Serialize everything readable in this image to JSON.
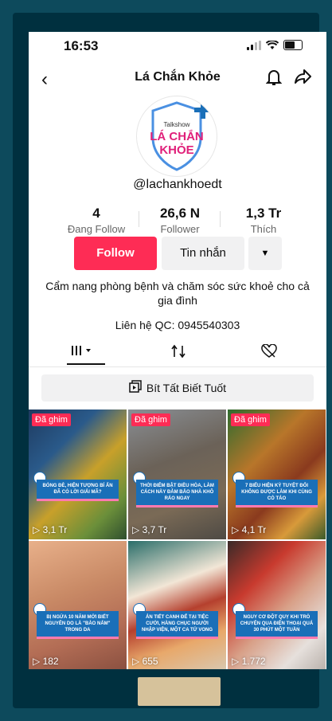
{
  "status_bar": {
    "time": "16:53"
  },
  "nav": {
    "title": "Lá Chắn Khỏe"
  },
  "avatar": {
    "line1": "Talkshow",
    "line2": "LÁ CHẮN",
    "line3": "KHỎE"
  },
  "profile": {
    "username": "@lachankhoedt",
    "stats": [
      {
        "value": "4",
        "label": "Đang Follow"
      },
      {
        "value": "26,6 N",
        "label": "Follower"
      },
      {
        "value": "1,3 Tr",
        "label": "Thích"
      }
    ],
    "follow_label": "Follow",
    "message_label": "Tin nhắn",
    "bio": "Cẩm nang phòng bệnh và chăm sóc sức khoẻ cho cả gia đình",
    "contact": "Liên hệ QC: 0945540303"
  },
  "playlist": {
    "label": "Bít Tất Biết Tuốt"
  },
  "colors": {
    "accent": "#fe2c55",
    "caption_bg": "#1a6fb8"
  },
  "videos": [
    {
      "pinned": "Đã ghim",
      "caption": "BÓNG ĐÈ, HIỆN TƯỢNG BÍ ẨN ĐÃ CÓ LỜI GIẢI MÃ?",
      "views": "3,1 Tr"
    },
    {
      "pinned": "Đã ghim",
      "caption": "THỜI ĐIỂM BẬT ĐIỀU HÒA, LÀM CÁCH NÀY ĐẢM BẢO NHÀ KHÔ RÁO NGAY",
      "views": "3,7 Tr"
    },
    {
      "pinned": "Đã ghim",
      "caption": "7 BIỂU HIỆN KỲ TUYỆT ĐỐI KHÔNG ĐƯỢC LÀM KHI CÙNG CÓ TÁO",
      "views": "4,1 Tr"
    },
    {
      "pinned": "",
      "caption": "BỊ NGỨA 10 NĂM MỚI BIẾT NGUYÊN DO LÀ \"BÀO NẤM\" TRONG DA",
      "views": "182"
    },
    {
      "pinned": "",
      "caption": "ẢN TIẾT CANH ĐỂ TẠI TIỆC CƯỚI, HÀNG CHỤC NGƯỜI NHẬP VIỆN, MỘT CA TỬ VONG",
      "views": "655"
    },
    {
      "pinned": "",
      "caption": "NGUY CƠ ĐỘT QUỴ KHI TRÒ CHUYỆN QUA ĐIỆN THOẠI QUÁ 30 PHÚT MỘT TUẦN",
      "views": "1.772"
    }
  ]
}
